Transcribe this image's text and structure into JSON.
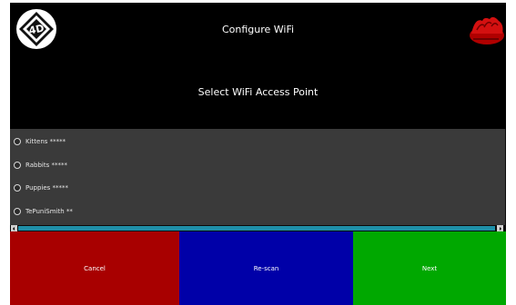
{
  "header": {
    "title": "Configure WiFi",
    "subtitle": "Select WiFi Access Point"
  },
  "access_points": [
    {
      "label": "Kittens *****",
      "selected": false
    },
    {
      "label": "Rabbits *****",
      "selected": false
    },
    {
      "label": "Puppies *****",
      "selected": false
    },
    {
      "label": "TePuniSmith **",
      "selected": false
    }
  ],
  "buttons": {
    "cancel": "Cancel",
    "rescan": "Re-scan",
    "next": "Next"
  },
  "colors": {
    "cancel": "#a80000",
    "rescan": "#0000a8",
    "next": "#00a800",
    "scrollbar": "#1f8fa8",
    "list_bg": "#3a3a3a"
  }
}
